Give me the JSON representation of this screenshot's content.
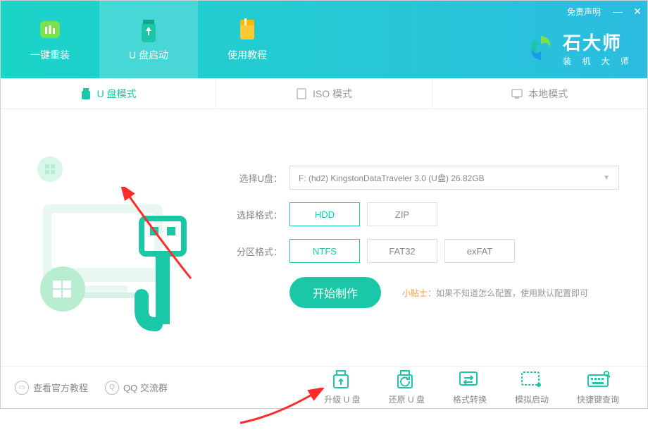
{
  "window": {
    "disclaimer": "免责声明",
    "minimize": "—",
    "close": "✕"
  },
  "brand": {
    "title": "石大师",
    "subtitle": "装 机 大 师"
  },
  "nav": {
    "items": [
      {
        "label": "一键重装"
      },
      {
        "label": "U 盘启动"
      },
      {
        "label": "使用教程"
      }
    ]
  },
  "modes": {
    "items": [
      {
        "label": "U 盘模式"
      },
      {
        "label": "ISO 模式"
      },
      {
        "label": "本地模式"
      }
    ]
  },
  "form": {
    "disk_label": "选择U盘：",
    "disk_value": "F: (hd2) KingstonDataTraveler 3.0 (U盘) 26.82GB",
    "format_label": "选择格式：",
    "format_options": [
      "HDD",
      "ZIP"
    ],
    "format_selected": "HDD",
    "partition_label": "分区格式：",
    "partition_options": [
      "NTFS",
      "FAT32",
      "exFAT"
    ],
    "partition_selected": "NTFS"
  },
  "action": {
    "start": "开始制作",
    "tip_label": "小贴士：",
    "tip_text": "如果不知道怎么配置，使用默认配置即可"
  },
  "footer": {
    "links": [
      {
        "label": "查看官方教程"
      },
      {
        "label": "QQ 交流群"
      }
    ],
    "actions": [
      {
        "label": "升级 U 盘"
      },
      {
        "label": "还原 U 盘"
      },
      {
        "label": "格式转换"
      },
      {
        "label": "模拟启动"
      },
      {
        "label": "快捷键查询"
      }
    ]
  }
}
